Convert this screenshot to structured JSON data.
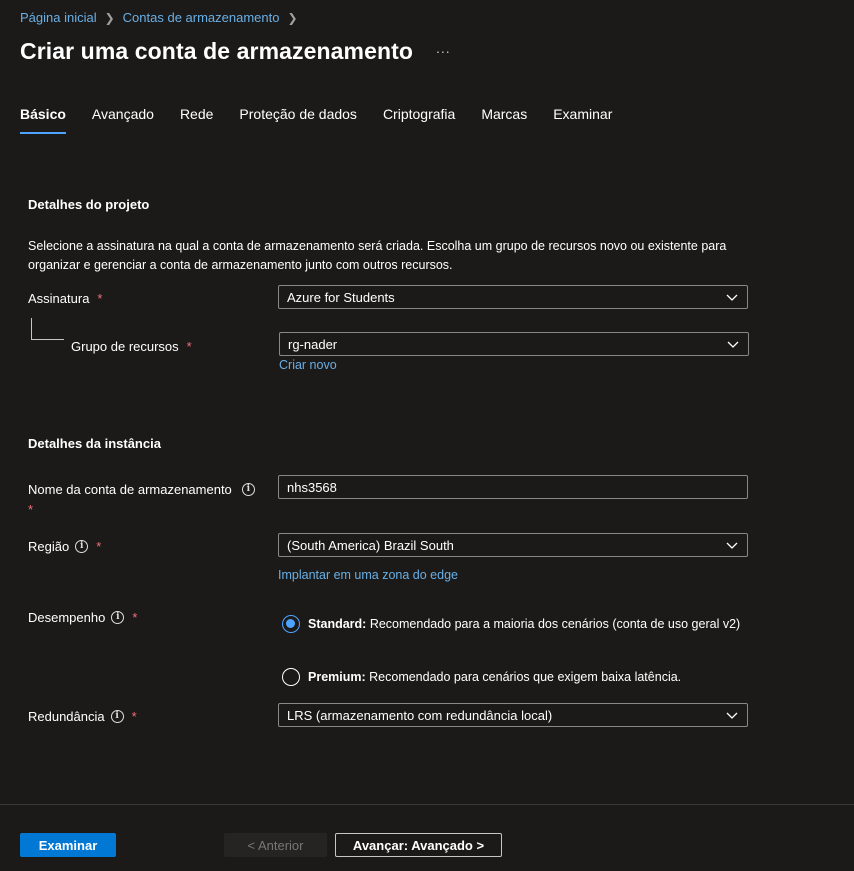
{
  "breadcrumb": [
    {
      "label": "Página inicial"
    },
    {
      "label": "Contas de armazenamento"
    }
  ],
  "header": {
    "title": "Criar uma conta de armazenamento",
    "more_icon": "ellipsis-icon",
    "more_label": "..."
  },
  "tabs": [
    {
      "label": "Básico",
      "active": true
    },
    {
      "label": "Avançado"
    },
    {
      "label": "Rede"
    },
    {
      "label": "Proteção de dados"
    },
    {
      "label": "Criptografia"
    },
    {
      "label": "Marcas"
    },
    {
      "label": "Examinar"
    }
  ],
  "project": {
    "title": "Detalhes do projeto",
    "description": "Selecione a assinatura na qual a conta de armazenamento será criada. Escolha um grupo de recursos novo ou existente para organizar e gerenciar a conta de armazenamento junto com outros recursos.",
    "subscription_label": "Assinatura",
    "subscription_value": "Azure for Students",
    "resource_group_label": "Grupo de recursos",
    "resource_group_value": "rg-nader",
    "create_new_link": "Criar novo"
  },
  "instance": {
    "title": "Detalhes da instância",
    "name_label": "Nome da conta de armazenamento",
    "name_value": "nhs3568",
    "region_label": "Região",
    "region_value": "(South America) Brazil South",
    "edge_link": "Implantar em uma zona do edge",
    "performance_label": "Desempenho",
    "performance_options": [
      {
        "name": "Standard:",
        "desc": "Recomendado para a maioria dos cenários (conta de uso geral v2)",
        "selected": true
      },
      {
        "name": "Premium:",
        "desc": "Recomendado para cenários que exigem baixa latência.",
        "selected": false
      }
    ],
    "redundancy_label": "Redundância",
    "redundancy_value": "LRS (armazenamento com redundância local)"
  },
  "required_mark": "*",
  "info_glyph": "i",
  "footer": {
    "review_button": "Examinar",
    "previous_button": "< Anterior",
    "next_button": "Avançar: Avançado >"
  },
  "colors": {
    "background": "#1b1a19",
    "accent": "#0078d4",
    "link": "#69afe5",
    "required": "#f1707b"
  }
}
